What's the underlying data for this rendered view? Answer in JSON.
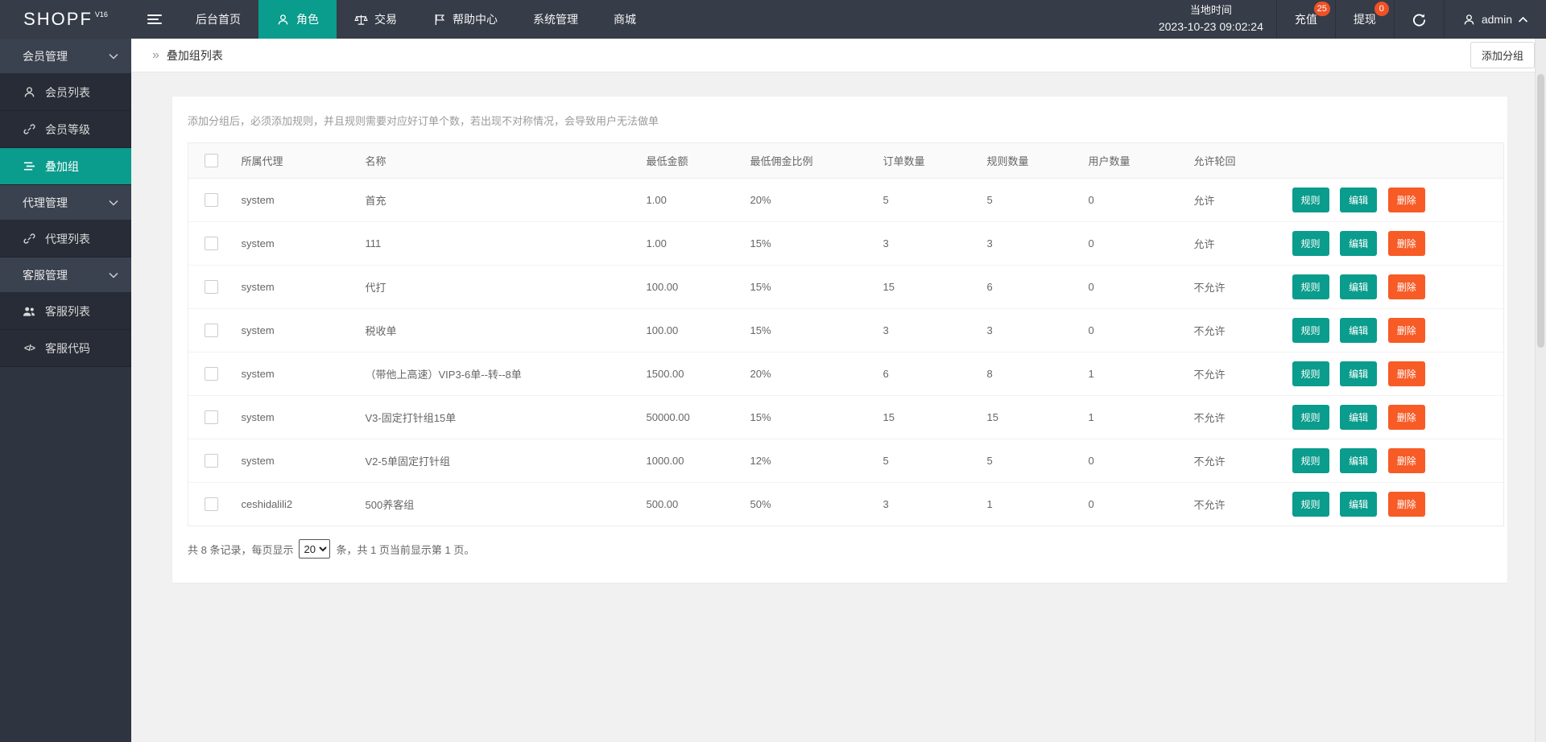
{
  "topbar": {
    "logo": "SHOPF",
    "logo_version": "V16",
    "menu": [
      {
        "label": "后台首页",
        "icon": null
      },
      {
        "label": "角色",
        "icon": "user-icon",
        "active": true
      },
      {
        "label": "交易",
        "icon": "scales-icon"
      },
      {
        "label": "帮助中心",
        "icon": "flag-icon"
      },
      {
        "label": "系统管理",
        "icon": null
      },
      {
        "label": "商城",
        "icon": null
      }
    ],
    "local_time_label": "当地时间",
    "local_time_value": "2023-10-23 09:02:24",
    "recharge_label": "充值",
    "recharge_badge": "25",
    "withdraw_label": "提现",
    "withdraw_badge": "0",
    "username": "admin"
  },
  "sidebar": {
    "groups": [
      {
        "label": "会员管理",
        "items": [
          {
            "label": "会员列表",
            "icon": "user-icon"
          },
          {
            "label": "会员等级",
            "icon": "link-icon"
          },
          {
            "label": "叠加组",
            "icon": "list-icon",
            "active": true
          }
        ]
      },
      {
        "label": "代理管理",
        "items": [
          {
            "label": "代理列表",
            "icon": "link-icon"
          }
        ]
      },
      {
        "label": "客服管理",
        "items": [
          {
            "label": "客服列表",
            "icon": "users-icon"
          },
          {
            "label": "客服代码",
            "icon": "code-icon"
          }
        ]
      }
    ]
  },
  "page": {
    "breadcrumb": "叠加组列表",
    "add_button": "添加分组",
    "hint": "添加分组后，必须添加规则，并且规则需要对应好订单个数，若出现不对称情况，会导致用户无法做单"
  },
  "table": {
    "columns": [
      "所属代理",
      "名称",
      "最低金额",
      "最低佣金比例",
      "订单数量",
      "规则数量",
      "用户数量",
      "允许轮回"
    ],
    "actions": [
      "规则",
      "编辑",
      "删除"
    ],
    "rows": [
      {
        "agent": "system",
        "name": "首充",
        "min_amount": "1.00",
        "commission": "20%",
        "orders": "5",
        "rules": "5",
        "users": "0",
        "loop": "允许"
      },
      {
        "agent": "system",
        "name": "111",
        "min_amount": "1.00",
        "commission": "15%",
        "orders": "3",
        "rules": "3",
        "users": "0",
        "loop": "允许"
      },
      {
        "agent": "system",
        "name": "代打",
        "min_amount": "100.00",
        "commission": "15%",
        "orders": "15",
        "rules": "6",
        "users": "0",
        "loop": "不允许"
      },
      {
        "agent": "system",
        "name": "税收单",
        "min_amount": "100.00",
        "commission": "15%",
        "orders": "3",
        "rules": "3",
        "users": "0",
        "loop": "不允许"
      },
      {
        "agent": "system",
        "name": "（带他上高速）VIP3-6单--转--8单",
        "min_amount": "1500.00",
        "commission": "20%",
        "orders": "6",
        "rules": "8",
        "users": "1",
        "loop": "不允许"
      },
      {
        "agent": "system",
        "name": "V3-固定打针组15单",
        "min_amount": "50000.00",
        "commission": "15%",
        "orders": "15",
        "rules": "15",
        "users": "1",
        "loop": "不允许"
      },
      {
        "agent": "system",
        "name": "V2-5单固定打针组",
        "min_amount": "1000.00",
        "commission": "12%",
        "orders": "5",
        "rules": "5",
        "users": "0",
        "loop": "不允许"
      },
      {
        "agent": "ceshidalili2",
        "name": "500养客组",
        "min_amount": "500.00",
        "commission": "50%",
        "orders": "3",
        "rules": "1",
        "users": "0",
        "loop": "不允许"
      }
    ]
  },
  "pagination": {
    "prefix": "共 8 条记录，每页显示",
    "per_page": "20",
    "suffix": "条，共 1 页当前显示第 1 页。"
  },
  "colors": {
    "accent_teal": "#0a9c8c",
    "delete_orange": "#f75b26",
    "badge_red": "#ee5126",
    "topbar_bg": "#363c48",
    "sidebar_bg": "#2f3540"
  }
}
